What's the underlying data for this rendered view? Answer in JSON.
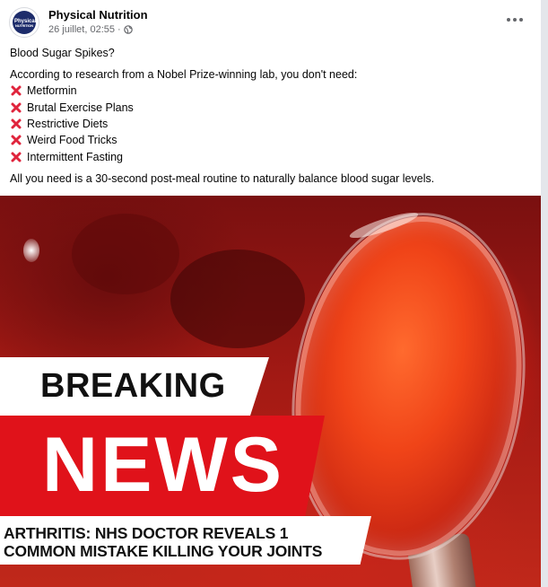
{
  "post": {
    "page_name": "Physical Nutrition",
    "avatar_line1": "Physical",
    "avatar_line2": "NUTRITION",
    "timestamp": "26 juillet, 02:55",
    "separator": "·",
    "privacy_icon": "globe-icon",
    "more_icon": "more-horizontal-icon"
  },
  "body": {
    "heading": "Blood Sugar Spikes?",
    "intro": "According to research from a Nobel Prize-winning lab, you don't need:",
    "list_icon": "cross-mark-icon",
    "list": [
      "Metformin",
      "Brutal Exercise Plans",
      "Restrictive Diets",
      "Weird Food Tricks",
      "Intermittent Fasting"
    ],
    "closing": "All you need is a 30-second post-meal routine to naturally balance blood sugar levels."
  },
  "image": {
    "breaking": "BREAKING",
    "news": "NEWS",
    "caption_line1": "ARTHRITIS: NHS DOCTOR REVEALS 1",
    "caption_line2": "COMMON MISTAKE KILLING YOUR JOINTS"
  },
  "colors": {
    "text_primary": "#050505",
    "text_secondary": "#65676b",
    "news_red": "#e0121a",
    "cross_red": "#e0243c"
  }
}
